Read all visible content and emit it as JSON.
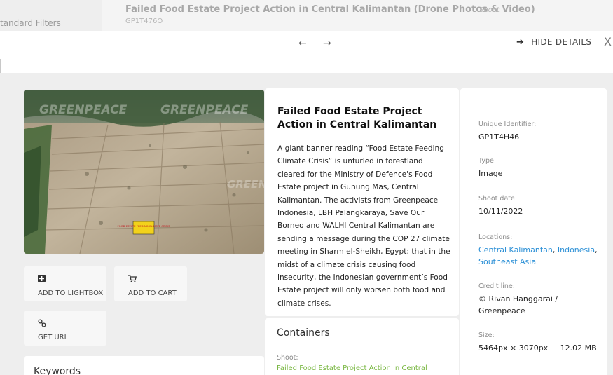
{
  "background": {
    "filters_label": "tandard Filters",
    "title": "Failed Food Estate Project Action in Central Kalimantan (Drone Photos & Video)",
    "shoot_tag": "Shoot",
    "code": "GP1T476O"
  },
  "modal": {
    "prev_arrow": "←",
    "next_arrow": "→",
    "hide_details_arrow": "➔",
    "hide_details_label": "HIDE DETAILS",
    "close": "X"
  },
  "photo": {
    "watermark_1": "GREENPEACE",
    "watermark_2": "GREENPEACE",
    "watermark_3": "GREENPE",
    "banner_text": "FOOD ESTATE FEEDING CLIMATE CRISIS"
  },
  "actions": {
    "lightbox": {
      "icon": "plus-square-icon",
      "label": "ADD TO LIGHTBOX"
    },
    "cart": {
      "icon": "cart-icon",
      "label": "ADD TO CART"
    },
    "url": {
      "icon": "link-icon",
      "label": "GET URL"
    }
  },
  "keywords": {
    "title": "Keywords"
  },
  "description": {
    "title": "Failed Food Estate Project Action in Central Kalimantan",
    "body": "A giant banner reading “Food Estate Feeding Climate Crisis” is unfurled in forestland cleared for the Ministry of Defence's Food Estate project in Gunung Mas, Central Kalimantan. The activists from Greenpeace Indonesia, LBH Palangkaraya, Save Our Borneo and WALHI Central Kalimantan are sending a message during the COP 27 climate meeting in Sharm el-Sheikh, Egypt: that in the midst of a climate crisis causing food insecurity, the Indonesian government’s Food Estate project will only worsen both food and climate crises."
  },
  "containers": {
    "title": "Containers",
    "shoot_label": "Shoot:",
    "shoot_link": "Failed Food Estate Project Action in Central"
  },
  "meta": {
    "uid_label": "Unique Identifier:",
    "uid_value": "GP1T4H46",
    "type_label": "Type:",
    "type_value": "Image",
    "date_label": "Shoot date:",
    "date_value": "10/11/2022",
    "loc_label": "Locations:",
    "loc_1": "Central Kalimantan",
    "loc_2": "Indonesia",
    "loc_3": "Southeast Asia",
    "credit_label": "Credit line:",
    "credit_value": "© Rivan Hanggarai / Greenpeace",
    "size_label": "Size:",
    "size_value": "5464px × 3070px     12.02 MB"
  },
  "colors": {
    "link_blue": "#2a8fd6",
    "link_green": "#79b742",
    "banner_yellow": "#f2d21b"
  }
}
